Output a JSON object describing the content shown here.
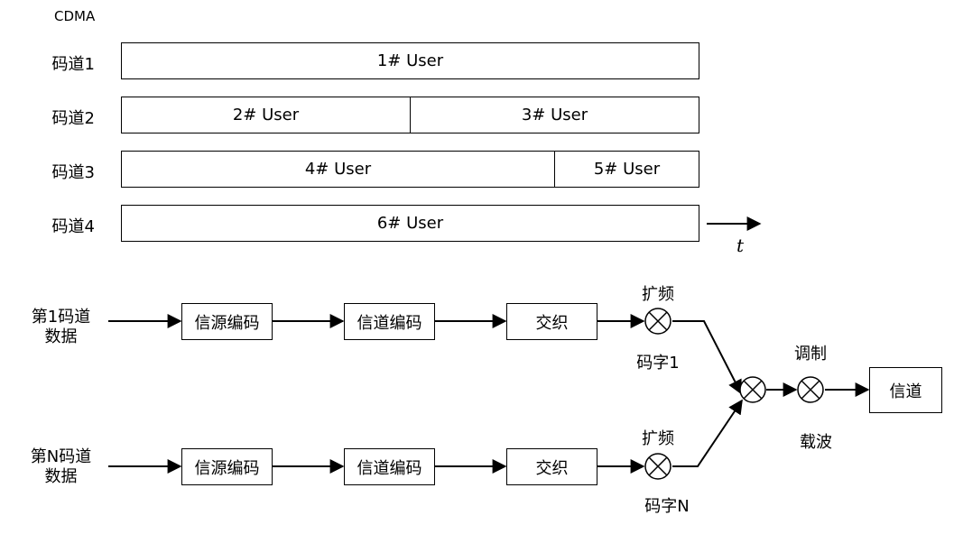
{
  "top": {
    "title": "CDMA",
    "channels": [
      {
        "label": "码道1",
        "slots": [
          "1# User"
        ]
      },
      {
        "label": "码道2",
        "slots": [
          "2# User",
          "3# User"
        ]
      },
      {
        "label": "码道3",
        "slots": [
          "4# User",
          "5# User"
        ]
      },
      {
        "label": "码道4",
        "slots": [
          "6# User"
        ]
      }
    ],
    "time_label": "t"
  },
  "bottom": {
    "rows": [
      {
        "input": [
          "第1码道",
          "数据"
        ],
        "blocks": [
          "信源编码",
          "信道编码",
          "交织"
        ],
        "spread": "扩频",
        "code": "码字1"
      },
      {
        "input": [
          "第N码道",
          "数据"
        ],
        "blocks": [
          "信源编码",
          "信道编码",
          "交织"
        ],
        "spread": "扩频",
        "code": "码字N"
      }
    ],
    "modulation": "调制",
    "carrier": "载波",
    "channel": "信道"
  }
}
